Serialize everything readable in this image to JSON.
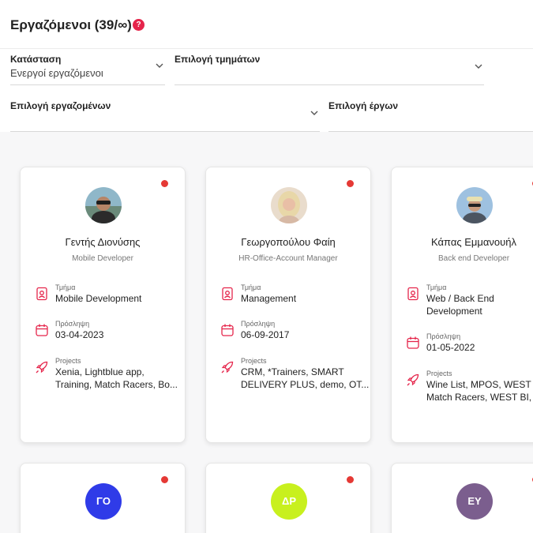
{
  "page": {
    "title": "Εργαζόμενοι (39/∞)",
    "help_badge": "?"
  },
  "filters": {
    "status": {
      "label": "Κατάσταση",
      "value": "Ενεργοί εργαζόμενοι"
    },
    "departments": {
      "label": "Επιλογή τμημάτων"
    },
    "employees": {
      "label": "Επιλογή εργαζομένων"
    },
    "projects": {
      "label": "Επιλογή έργων"
    }
  },
  "info_labels": {
    "department": "Τμήμα",
    "hire_date": "Πρόσληψη",
    "projects": "Projects"
  },
  "colors": {
    "accent": "#e5254b",
    "status_dot": "#e53935"
  },
  "employees": [
    {
      "name": "Γεντής Διονύσης",
      "role": "Mobile Developer",
      "department_line1": "Mobile Development",
      "hire_date": "03-04-2023",
      "projects_line1": "Xenia, Lightblue app,",
      "projects_line2": "Training, Match Racers, Bo..."
    },
    {
      "name": "Γεωργοπούλου Φαίη",
      "role": "HR-Office-Account Manager",
      "department_line1": "Management",
      "hire_date": "06-09-2017",
      "projects_line1": "CRM, *Trainers, SMART",
      "projects_line2": "DELIVERY PLUS, demo, OT..."
    },
    {
      "name": "Κάπας Εμμανουήλ",
      "role": "Back end Developer",
      "department_line1": "Web / Back End",
      "department_line2": "Development",
      "hire_date": "01-05-2022",
      "projects_line1": "Wine List, MPOS, WEST AZ",
      "projects_line2": "Match Racers, WEST BI, *T"
    }
  ],
  "initials_cards": [
    {
      "initials": "ΓΟ",
      "color": "#2f3be8"
    },
    {
      "initials": "ΔΡ",
      "color": "#c8f01e"
    },
    {
      "initials": "ΕΥ",
      "color": "#7b5e8e"
    }
  ]
}
